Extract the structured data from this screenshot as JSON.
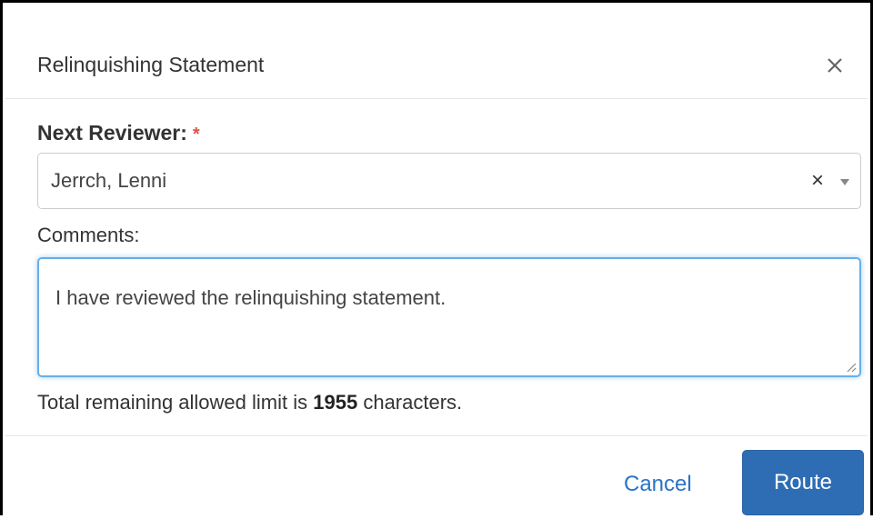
{
  "dialog": {
    "title": "Relinquishing Statement",
    "close_icon": "close-icon"
  },
  "reviewer": {
    "label": "Next Reviewer:",
    "required_marker": "*",
    "selected_value": "Jerrch, Lenni",
    "clear_glyph": "×",
    "arrow_icon": "chevron-down-icon"
  },
  "comments": {
    "label": "Comments:",
    "value": "I have reviewed the relinquishing statement."
  },
  "limit": {
    "prefix": "Total remaining allowed limit is",
    "count": "1955",
    "suffix": "characters."
  },
  "footer": {
    "cancel_label": "Cancel",
    "route_label": "Route"
  },
  "colors": {
    "required": "#d9534f",
    "primary": "#2e6db4",
    "link": "#2a73c7",
    "focus": "#66afe9"
  }
}
